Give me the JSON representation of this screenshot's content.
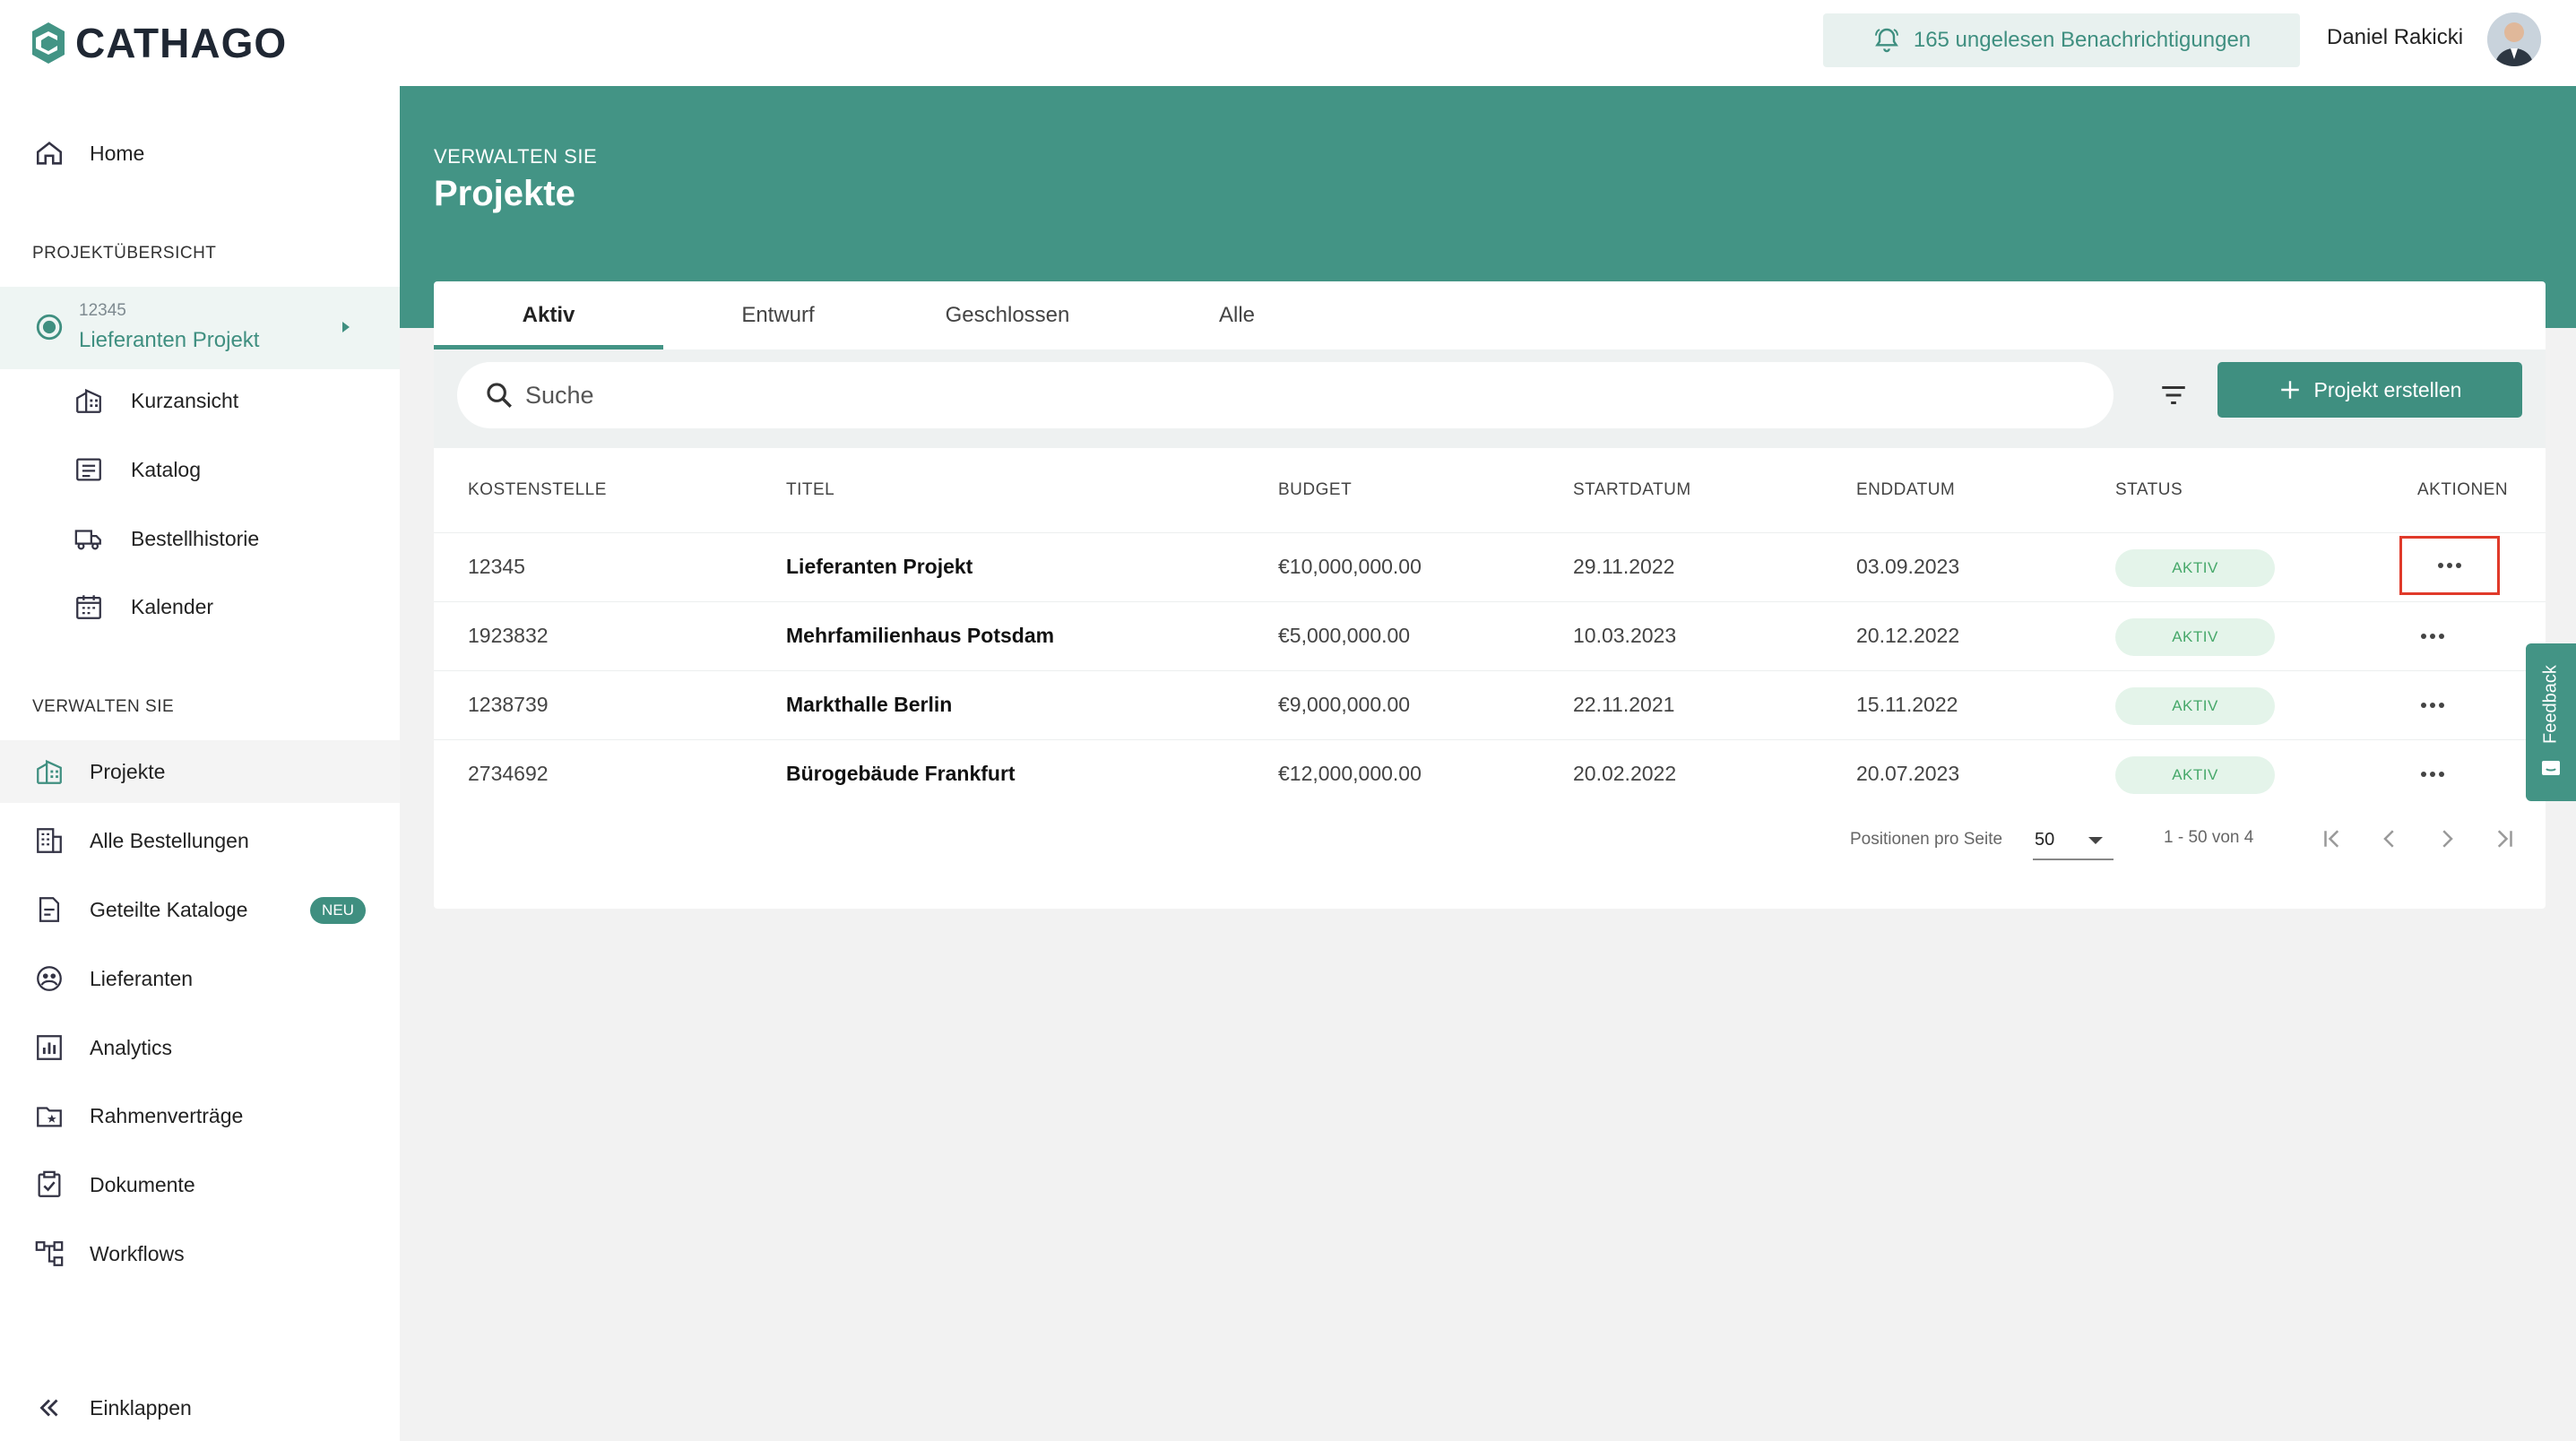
{
  "brand": {
    "name": "CATHAGO",
    "accent": "#439485",
    "accent_dark": "#3f8f80"
  },
  "topbar": {
    "notifications": "165 ungelesen Benachrichtigungen",
    "user_name": "Daniel Rakicki"
  },
  "sidebar": {
    "home": "Home",
    "section_project": "PROJEKTÜBERSICHT",
    "current_project": {
      "number": "12345",
      "name": "Lieferanten Projekt"
    },
    "project_items": [
      {
        "label": "Kurzansicht",
        "icon": "building-icon"
      },
      {
        "label": "Katalog",
        "icon": "catalog-icon"
      },
      {
        "label": "Bestellhistorie",
        "icon": "truck-icon"
      },
      {
        "label": "Kalender",
        "icon": "calendar-icon"
      }
    ],
    "section_manage": "VERWALTEN SIE",
    "manage_items": [
      {
        "label": "Projekte",
        "icon": "building-icon"
      },
      {
        "label": "Alle Bestellungen",
        "icon": "building-grid-icon"
      },
      {
        "label": "Geteilte Kataloge",
        "icon": "shared-doc-icon",
        "badge": "NEU"
      },
      {
        "label": "Lieferanten",
        "icon": "supplier-icon"
      },
      {
        "label": "Analytics",
        "icon": "chart-icon"
      },
      {
        "label": "Rahmenverträge",
        "icon": "folder-star-icon"
      },
      {
        "label": "Dokumente",
        "icon": "clipboard-icon"
      },
      {
        "label": "Workflows",
        "icon": "workflow-icon"
      }
    ],
    "collapse": "Einklappen"
  },
  "header": {
    "eyebrow": "VERWALTEN SIE",
    "title": "Projekte"
  },
  "tabs": [
    "Aktiv",
    "Entwurf",
    "Geschlossen",
    "Alle"
  ],
  "search": {
    "placeholder": "Suche"
  },
  "create_button": "Projekt erstellen",
  "table": {
    "columns": [
      "KOSTENSTELLE",
      "TITEL",
      "BUDGET",
      "STARTDATUM",
      "ENDDATUM",
      "STATUS",
      "AKTIONEN"
    ],
    "rows": [
      {
        "cost_center": "12345",
        "title": "Lieferanten Projekt",
        "budget": "€10,000,000.00",
        "start": "29.11.2022",
        "end": "03.09.2023",
        "status": "AKTIV"
      },
      {
        "cost_center": "1923832",
        "title": "Mehrfamilienhaus Potsdam",
        "budget": "€5,000,000.00",
        "start": "10.03.2023",
        "end": "20.12.2022",
        "status": "AKTIV"
      },
      {
        "cost_center": "1238739",
        "title": "Markthalle Berlin",
        "budget": "€9,000,000.00",
        "start": "22.11.2021",
        "end": "15.11.2022",
        "status": "AKTIV"
      },
      {
        "cost_center": "2734692",
        "title": "Bürogebäude Frankfurt",
        "budget": "€12,000,000.00",
        "start": "20.02.2022",
        "end": "20.07.2023",
        "status": "AKTIV"
      }
    ]
  },
  "pagination": {
    "per_page_label": "Positionen pro Seite",
    "per_page": "50",
    "range": "1 - 50 von 4"
  },
  "feedback": "Feedback"
}
